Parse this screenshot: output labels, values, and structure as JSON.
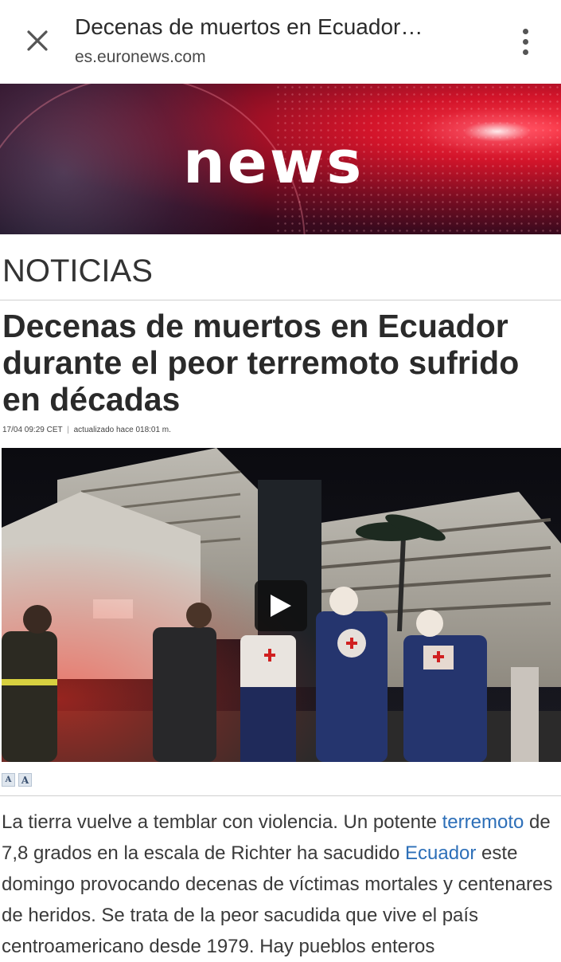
{
  "browser": {
    "title": "Decenas de muertos en Ecuador…",
    "url": "es.euronews.com",
    "close_icon": "close-icon",
    "menu_icon": "more-vertical-icon"
  },
  "banner": {
    "logo_text": "news"
  },
  "article": {
    "section": "NOTICIAS",
    "headline": "Decenas de muertos en Ecuador durante el peor terremoto sufrido en décadas",
    "date": "17/04 09:29 CET",
    "updated": "actualizado hace 018:01 m.",
    "font_small": "A",
    "font_large": "A",
    "body": {
      "part1": "La tierra vuelve a temblar con violencia. Un potente ",
      "link1": "terremoto",
      "part2": " de 7,8 grados en la escala de Richter ha sacudido ",
      "link2": "Ecuador",
      "part3": " este domingo provocando decenas de víctimas mortales y centenares de heridos. Se trata de la peor sacudida que vive el país centroamericano desde 1979. Hay pueblos enteros"
    }
  },
  "colors": {
    "link": "#2d6fb8",
    "banner_red": "#d2142a"
  }
}
